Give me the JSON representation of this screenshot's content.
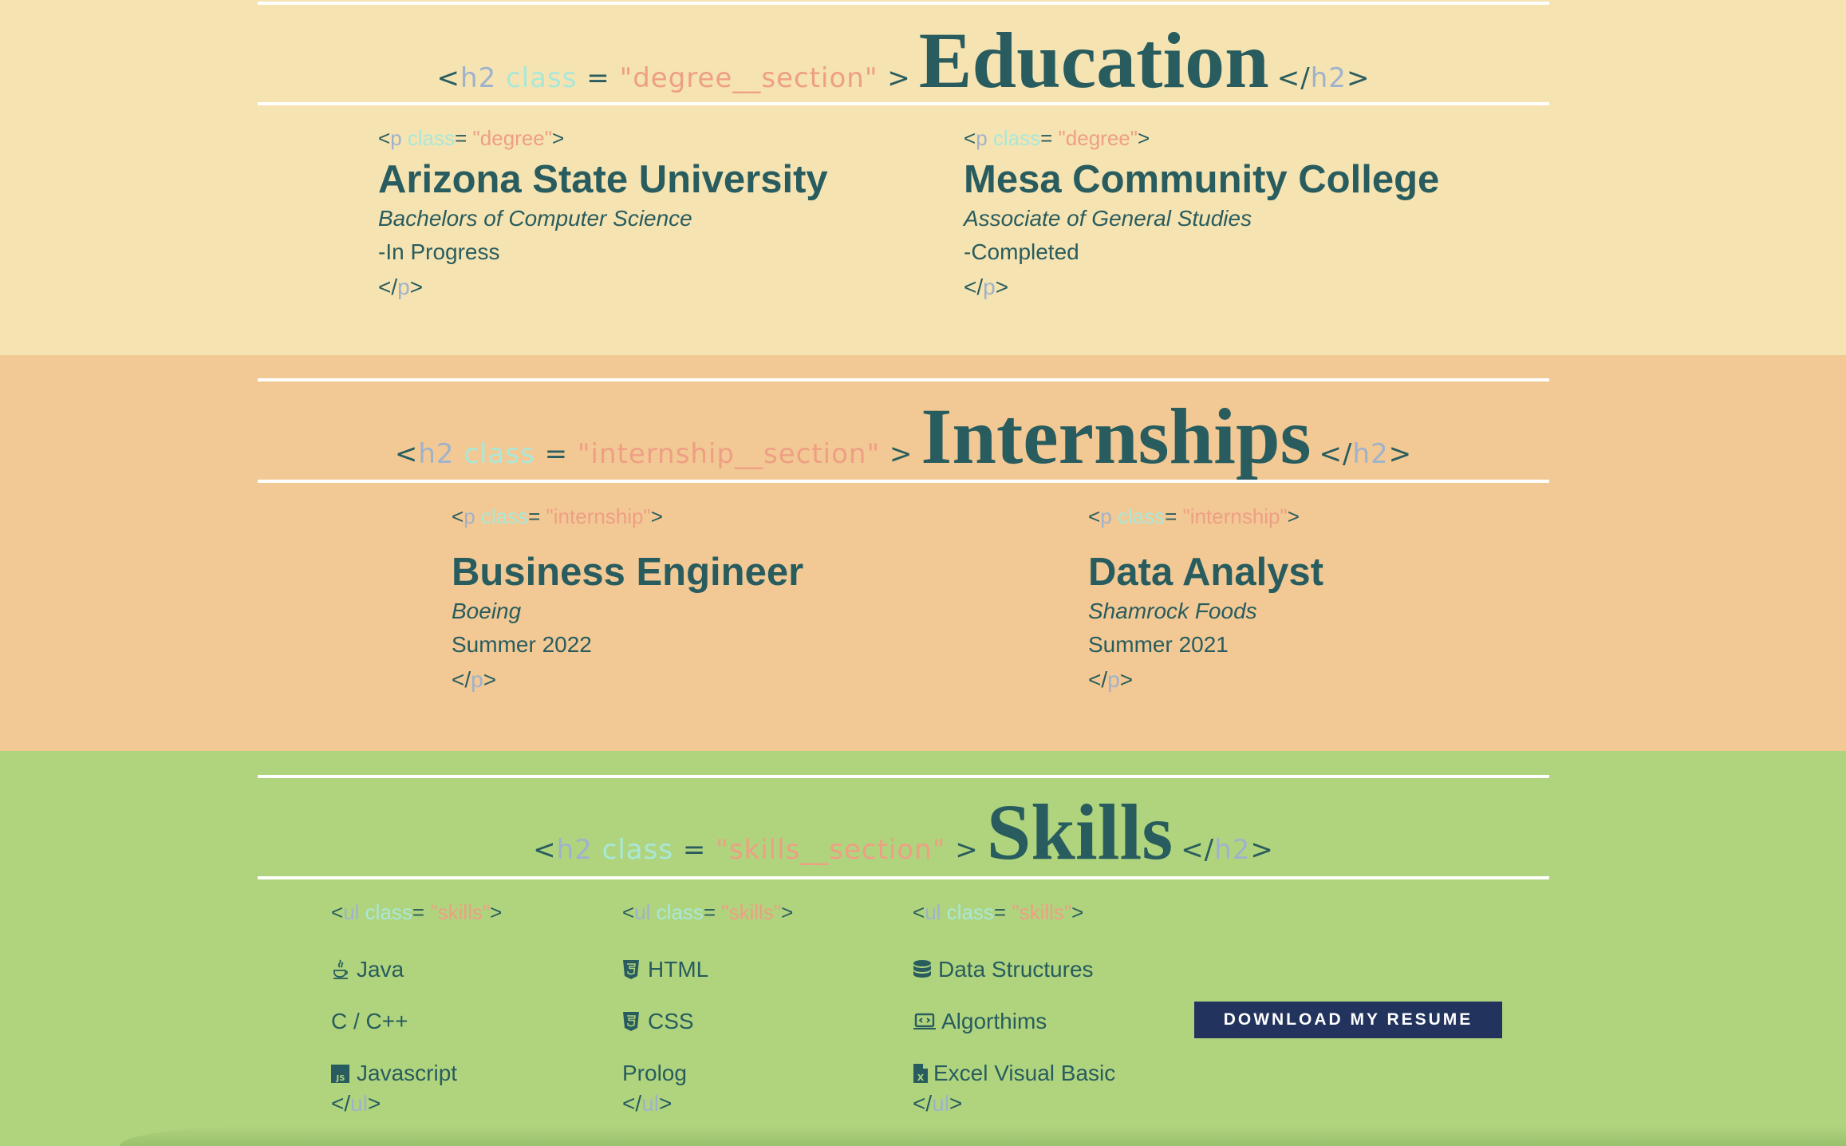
{
  "education": {
    "tag_open": "<",
    "tag_name": "h2",
    "tag_attr": "class",
    "tag_eq": "=",
    "tag_value": "\"degree__section\"",
    "tag_gt": ">",
    "title": "Education",
    "close_open": "</",
    "close_name": "h2",
    "close_gt": ">",
    "items": [
      {
        "p_open": "<",
        "p_name": "p",
        "p_attr": "class",
        "p_eq": "=",
        "p_value": " \"degree\"",
        "p_gt": ">",
        "title": "Arizona State University",
        "subtitle": "Bachelors of Computer Science",
        "status": "-In Progress",
        "close_open": "</",
        "close_name": "p",
        "close_gt": ">"
      },
      {
        "p_open": "<",
        "p_name": "p",
        "p_attr": "class",
        "p_eq": "=",
        "p_value": " \"degree\"",
        "p_gt": ">",
        "title": "Mesa Community College",
        "subtitle": "Associate of General Studies",
        "status": "-Completed",
        "close_open": "</",
        "close_name": "p",
        "close_gt": ">"
      }
    ]
  },
  "internships": {
    "tag_open": "<",
    "tag_name": "h2",
    "tag_attr": "class",
    "tag_eq": "=",
    "tag_value": "\"internship__section\"",
    "tag_gt": ">",
    "title": "Internships",
    "close_open": "</",
    "close_name": "h2",
    "close_gt": ">",
    "items": [
      {
        "p_open": "<",
        "p_name": "p",
        "p_attr": "class",
        "p_eq": "=",
        "p_value": " \"internship\"",
        "p_gt": ">",
        "title": "Business Engineer",
        "company": "Boeing",
        "period": "Summer 2022",
        "close_open": "</",
        "close_name": "p",
        "close_gt": ">"
      },
      {
        "p_open": "<",
        "p_name": "p",
        "p_attr": "class",
        "p_eq": "=",
        "p_value": " \"internship\"",
        "p_gt": ">",
        "title": "Data Analyst",
        "company": "Shamrock Foods",
        "period": "Summer 2021",
        "close_open": "</",
        "close_name": "p",
        "close_gt": ">"
      }
    ]
  },
  "skills": {
    "tag_open": "<",
    "tag_name": "h2",
    "tag_attr": "class",
    "tag_eq": "=",
    "tag_value": "\"skills__section\"",
    "tag_gt": ">",
    "title": "Skills",
    "close_open": "</",
    "close_name": "h2",
    "close_gt": ">",
    "ul_open": "<",
    "ul_name": "ul",
    "ul_attr": "class",
    "ul_eq": "=",
    "ul_value": " \"skills\"",
    "ul_gt": ">",
    "ul_close_open": "</",
    "ul_close_name": "ul",
    "ul_close_gt": ">",
    "columns": [
      [
        {
          "label": "Java",
          "icon": "java-icon"
        },
        {
          "label": "C / C++",
          "icon": "c-icon"
        },
        {
          "label": "Javascript",
          "icon": "js-icon"
        }
      ],
      [
        {
          "label": "HTML",
          "icon": "html5-icon"
        },
        {
          "label": "CSS",
          "icon": "css3-icon"
        },
        {
          "label": "Prolog",
          "icon": ""
        }
      ],
      [
        {
          "label": "Data Structures",
          "icon": "database-icon"
        },
        {
          "label": "Algorthims",
          "icon": "laptop-code-icon"
        },
        {
          "label": "Excel Visual Basic",
          "icon": "file-excel-icon"
        }
      ]
    ],
    "download_label": "DOWNLOAD MY RESUME"
  },
  "colors": {
    "education_bg": "#f6e3b2",
    "internships_bg": "#f2c994",
    "skills_bg": "#b0d47e",
    "text": "#285c5e",
    "tag_name": "#9fb2cc",
    "tag_attr": "#a9e8d8",
    "tag_value": "#ee9f84",
    "button_bg": "#22345e"
  }
}
